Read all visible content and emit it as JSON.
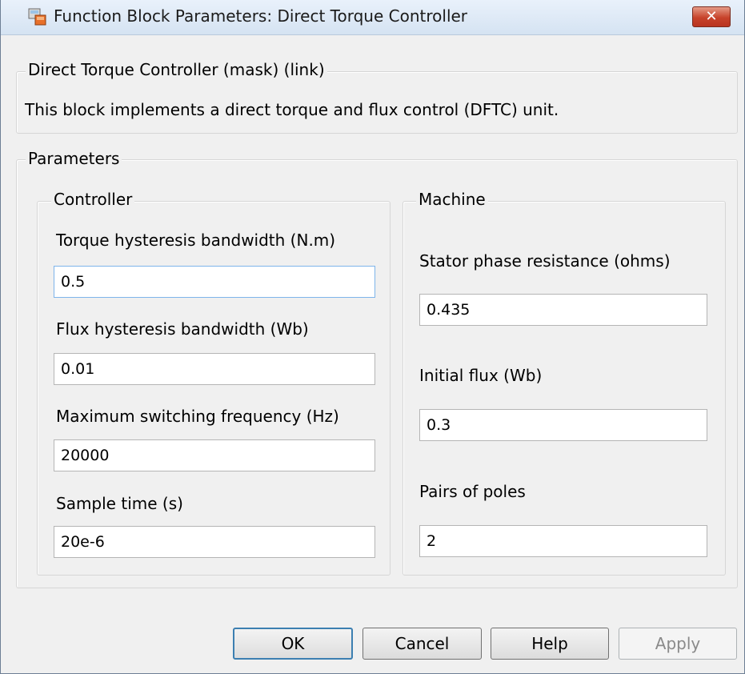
{
  "window": {
    "title": "Function Block Parameters: Direct Torque Controller"
  },
  "mask": {
    "legend": "Direct Torque Controller (mask) (link)",
    "description": "This block implements a direct torque and flux control (DFTC) unit."
  },
  "parameters": {
    "legend": "Parameters",
    "controller": {
      "legend": "Controller",
      "fields": [
        {
          "label": "Torque hysteresis bandwidth (N.m)",
          "value": "0.5"
        },
        {
          "label": "Flux hysteresis bandwidth (Wb)",
          "value": "0.01"
        },
        {
          "label": "Maximum switching frequency (Hz)",
          "value": "20000"
        },
        {
          "label": "Sample time (s)",
          "value": "20e-6"
        }
      ]
    },
    "machine": {
      "legend": "Machine",
      "fields": [
        {
          "label": "Stator phase resistance (ohms)",
          "value": "0.435"
        },
        {
          "label": "Initial flux (Wb)",
          "value": "0.3"
        },
        {
          "label": "Pairs of poles",
          "value": "2"
        }
      ]
    }
  },
  "buttons": {
    "ok": "OK",
    "cancel": "Cancel",
    "help": "Help",
    "apply": "Apply"
  },
  "colors": {
    "default_button_border": "#3c7fb1",
    "close_button": "#c7422a",
    "focus_border": "#7eb4ea"
  }
}
